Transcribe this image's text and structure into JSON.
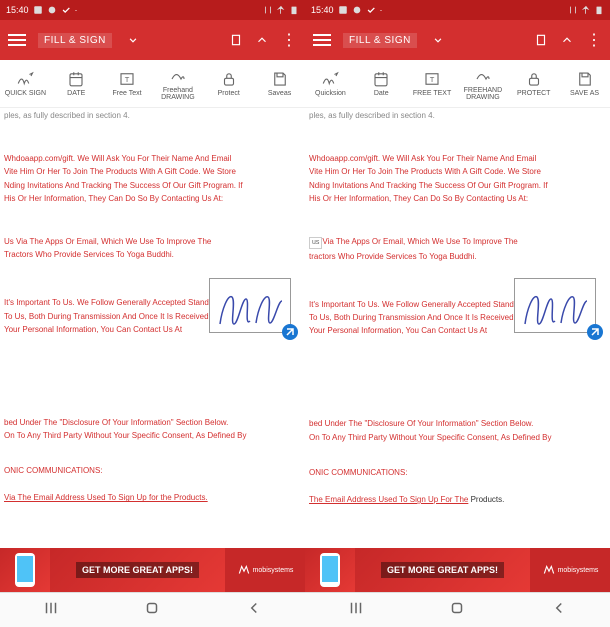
{
  "status": {
    "time": "15:40",
    "icons": [
      "image-icon",
      "sync-icon",
      "check-icon"
    ]
  },
  "appbar": {
    "title": "FILL & SIGN"
  },
  "toolbar_left": [
    {
      "label": "QUICK SIGN",
      "icon": "signature"
    },
    {
      "label": "DATE",
      "icon": "calendar"
    },
    {
      "label": "Free Text",
      "icon": "text"
    },
    {
      "label": "Freehand DRAWING",
      "icon": "freehand"
    },
    {
      "label": "Protect",
      "icon": "lock"
    },
    {
      "label": "Saveas",
      "icon": "save"
    }
  ],
  "toolbar_right": [
    {
      "label": "Quicksion",
      "icon": "signature"
    },
    {
      "label": "Date",
      "icon": "calendar"
    },
    {
      "label": "FREE TEXT",
      "icon": "text"
    },
    {
      "label": "FREEHAND DRAWING",
      "icon": "freehand"
    },
    {
      "label": "PROTECT",
      "icon": "lock"
    },
    {
      "label": "SAVE AS",
      "icon": "save"
    }
  ],
  "doc": {
    "line0": "ples, as fully described in section 4.",
    "line1": "Whdoaapp.com/gift. We Will Ask You For Their Name And Email",
    "line2": "Vite Him Or Her To Join The Products With A Gift Code. We Store",
    "line3": "Nding Invitations And Tracking The Success Of Our Gift Program. If",
    "line4": "His Or Her Information, They Can Do So By Contacting Us At:",
    "line5a": "Us Via The Apps Or Email, Which We Use To Improve The",
    "line5b": "Via The Apps Or Email, Which We Use To Improve The",
    "line6a": "Tractors Who Provide Services To Yoga Buddhi.",
    "line6b": "tractors Who Provide Services To Yoga Buddhi.",
    "line7": "It's Important To Us. We Follow Generally Accepted Standards To",
    "line8": "To Us, Both During Transmission And Once It Is Received. If You",
    "line9": "Your Personal Information, You Can Contact Us At",
    "line10": "bed Under The \"Disclosure Of Your Information\" Section Below.",
    "line11": "On To Any Third Party Without Your Specific Consent, As Defined By",
    "line12": "ONIC COMMUNICATIONS:",
    "line13a": "Via The Email Address Used To Sign Up for the Products.",
    "line13b": "The Email Address Used To Sign Up For The",
    "line13c": "Products.",
    "us_label": "us"
  },
  "ad": {
    "text": "GET MORE GREAT APPS!",
    "vendor": "mobisystems"
  }
}
